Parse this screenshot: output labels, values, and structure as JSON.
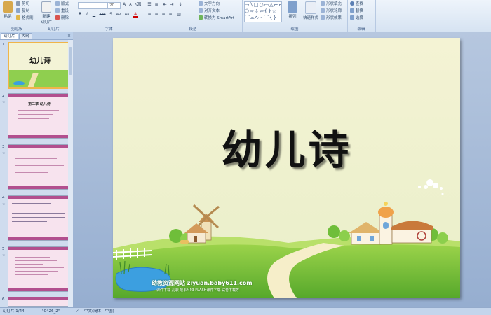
{
  "ribbon": {
    "clipboard": {
      "label": "剪贴板",
      "paste": "粘贴",
      "cut": "剪切",
      "copy": "复制",
      "format_painter": "格式刷"
    },
    "slides": {
      "label": "幻灯片",
      "new_slide": "新建\n幻灯片",
      "layout": "版式",
      "reset": "重设",
      "delete": "删除"
    },
    "font": {
      "label": "字体",
      "font_name": "",
      "font_size": "20",
      "bold": "B",
      "italic": "I",
      "underline": "U",
      "strike": "abc",
      "shadow": "S",
      "spacing": "AV",
      "case": "Aa",
      "color": "A"
    },
    "paragraph": {
      "label": "段落",
      "text_direction": "文字方向",
      "align_text": "对齐文本",
      "smartart": "转换为 SmartArt"
    },
    "drawing": {
      "label": "绘图",
      "arrange": "排列",
      "quick_styles": "快速样式",
      "shape_fill": "形状填充",
      "shape_outline": "形状轮廓",
      "shape_effects": "形状效果"
    },
    "editing": {
      "label": "编辑",
      "find": "查找",
      "replace": "替换",
      "select": "选择"
    }
  },
  "panel": {
    "tabs": [
      "幻灯片",
      "大纲"
    ],
    "close": "×",
    "thumbs": [
      {
        "num": "1",
        "title": "幼儿诗"
      },
      {
        "num": "2",
        "title": "第二章  幼儿诗"
      },
      {
        "num": "3",
        "title": ""
      },
      {
        "num": "4",
        "title": ""
      },
      {
        "num": "5",
        "title": ""
      },
      {
        "num": "6",
        "title": ""
      }
    ]
  },
  "slide": {
    "title": "幼儿诗",
    "credit": "幼教资源网站  ziyuan.baby611.com",
    "credit_sub": "课件下载  儿歌  故事MP3  FLASH课件下载  试卷下载等"
  },
  "status": {
    "slide_pos": "幻灯片 1/44",
    "theme": "\"0426_2\"",
    "lang": "中文(简体，中国)"
  },
  "colors": {
    "accent": "#b24f8e",
    "ribbon": "#d6e3f2",
    "grass": "#7cc341"
  }
}
